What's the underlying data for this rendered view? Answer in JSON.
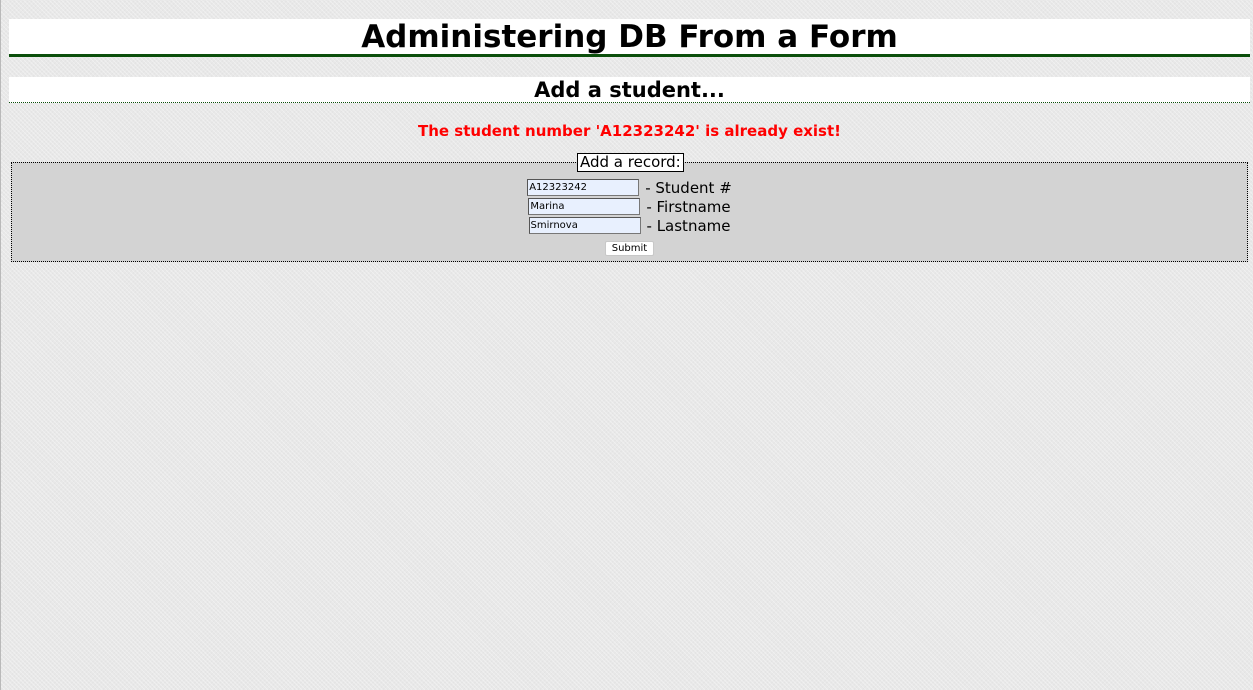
{
  "header": {
    "title": "Administering DB From a Form",
    "subtitle": "Add a student..."
  },
  "message": {
    "error": "The student number 'A12323242' is already exist!"
  },
  "form": {
    "legend": "Add a record:",
    "fields": [
      {
        "value": "A12323242",
        "label": "- Student #"
      },
      {
        "value": "Marina",
        "label": "- Firstname"
      },
      {
        "value": "Smirnova",
        "label": "- Lastname"
      }
    ],
    "submit_label": "Submit"
  },
  "colors": {
    "background": "#e8e8e8",
    "header_bg": "#ffffff",
    "header_rule": "#0b4f0b",
    "error_text": "#ff0000",
    "form_bg": "#d3d3d3",
    "input_bg": "#e8f0fe"
  }
}
